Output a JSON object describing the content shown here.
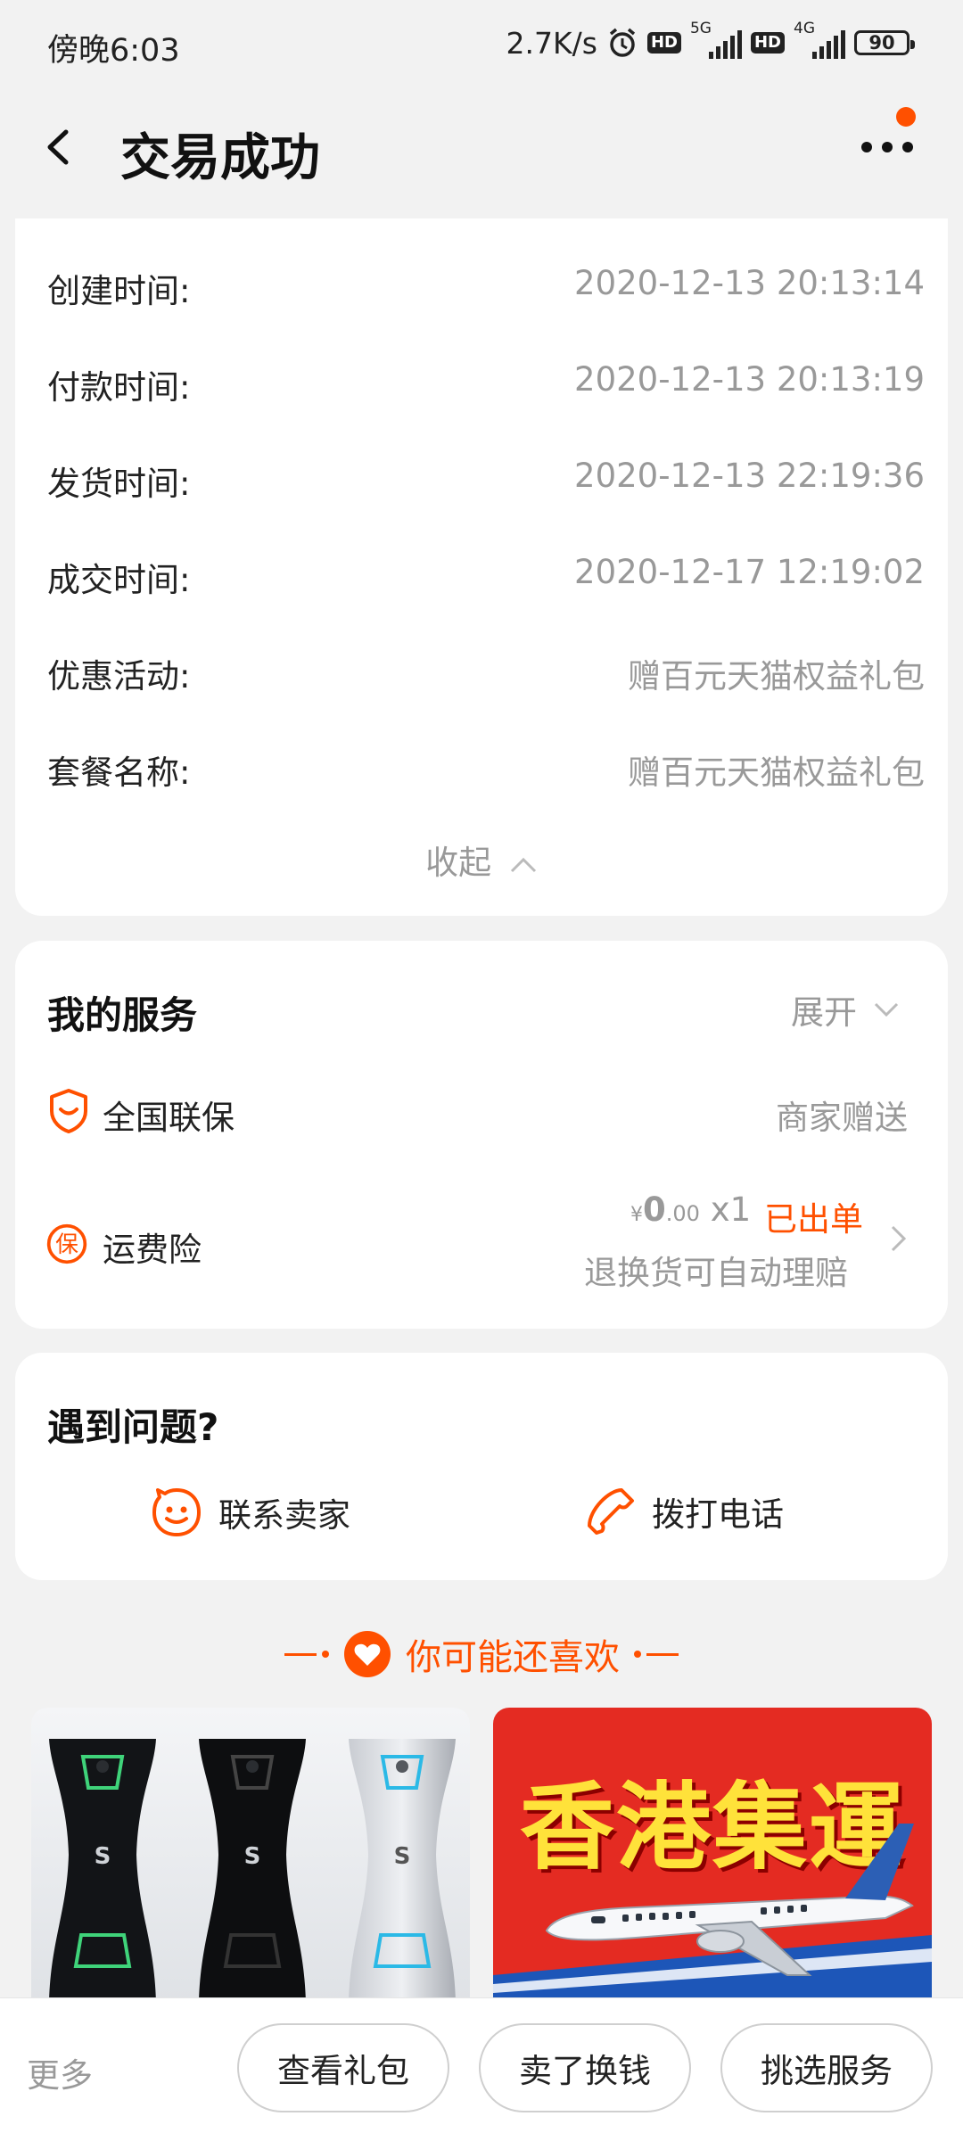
{
  "status_bar": {
    "time": "傍晚6:03",
    "net_speed": "2.7K/s",
    "hd_label": "HD",
    "net_5g": "5G",
    "net_4g": "4G",
    "battery": "90"
  },
  "header": {
    "title": "交易成功",
    "has_notification_dot": true
  },
  "order_details": {
    "rows": [
      {
        "label": "创建时间:",
        "value": "2020-12-13 20:13:14"
      },
      {
        "label": "付款时间:",
        "value": "2020-12-13 20:13:19"
      },
      {
        "label": "发货时间:",
        "value": "2020-12-13 22:19:36"
      },
      {
        "label": "成交时间:",
        "value": "2020-12-17 12:19:02"
      },
      {
        "label": "优惠活动:",
        "value": "赠百元天猫权益礼包"
      },
      {
        "label": "套餐名称:",
        "value": "赠百元天猫权益礼包"
      }
    ],
    "collapse_label": "收起"
  },
  "services": {
    "title": "我的服务",
    "expand_label": "展开",
    "warranty": {
      "label": "全国联保",
      "value": "商家赠送"
    },
    "shipping_insurance": {
      "label": "运费险",
      "currency": "¥",
      "price_int": "0",
      "price_dec": ".00",
      "quantity": "x1",
      "status": "已出单",
      "note": "退换货可自动理赔"
    }
  },
  "help": {
    "title": "遇到问题?",
    "contact_seller": "联系卖家",
    "call_phone": "拨打电话"
  },
  "recommend": {
    "title": "你可能还喜欢",
    "product_b_text": "香港集運"
  },
  "bottom_bar": {
    "more": "更多",
    "buttons": [
      "查看礼包",
      "卖了换钱",
      "挑选服务"
    ]
  },
  "colors": {
    "accent": "#ff5000",
    "background": "#f2f2f2",
    "muted_text": "#999999"
  }
}
